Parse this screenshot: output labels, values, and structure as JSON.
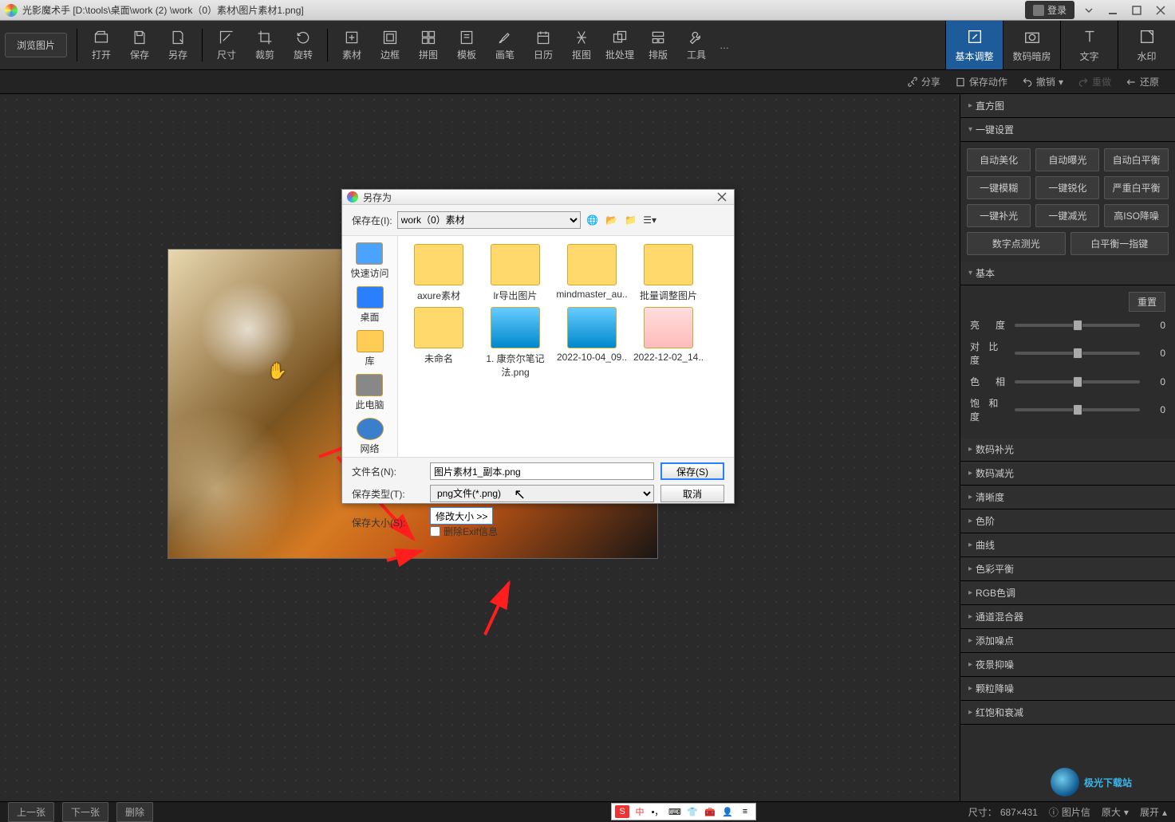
{
  "title": "光影魔术手  [D:\\tools\\桌面\\work (2) \\work（0）素材\\图片素材1.png]",
  "login_label": "登录",
  "toolbar": {
    "browse": "浏览图片",
    "items": [
      {
        "key": "open",
        "label": "打开"
      },
      {
        "key": "save",
        "label": "保存"
      },
      {
        "key": "saveas",
        "label": "另存"
      },
      {
        "key": "size",
        "label": "尺寸"
      },
      {
        "key": "crop",
        "label": "裁剪"
      },
      {
        "key": "rotate",
        "label": "旋转"
      },
      {
        "key": "material",
        "label": "素材"
      },
      {
        "key": "border",
        "label": "边框"
      },
      {
        "key": "collage",
        "label": "拼图"
      },
      {
        "key": "template",
        "label": "模板"
      },
      {
        "key": "brush",
        "label": "画笔"
      },
      {
        "key": "calendar",
        "label": "日历"
      },
      {
        "key": "cutout",
        "label": "抠图"
      },
      {
        "key": "batch",
        "label": "批处理"
      },
      {
        "key": "layout",
        "label": "排版"
      },
      {
        "key": "tools",
        "label": "工具"
      }
    ],
    "more": "…",
    "right_tabs": [
      {
        "key": "basic",
        "label": "基本调整",
        "active": true
      },
      {
        "key": "darkroom",
        "label": "数码暗房",
        "active": false
      },
      {
        "key": "text",
        "label": "文字",
        "active": false
      },
      {
        "key": "watermark",
        "label": "水印",
        "active": false
      }
    ]
  },
  "actions": {
    "share": "分享",
    "save_action": "保存动作",
    "undo": "撤销",
    "redo": "重做",
    "restore": "还原"
  },
  "panel": {
    "histogram": "直方图",
    "onekey_title": "一键设置",
    "onekey": [
      "自动美化",
      "自动曝光",
      "自动白平衡",
      "一键模糊",
      "一键锐化",
      "严重白平衡",
      "一键补光",
      "一键减光",
      "高ISO降噪",
      "数字点测光",
      "白平衡一指键"
    ],
    "basic_title": "基本",
    "reset": "重置",
    "sliders": [
      {
        "label": "亮　度",
        "value": "0"
      },
      {
        "label": "对 比 度",
        "value": "0"
      },
      {
        "label": "色　相",
        "value": "0"
      },
      {
        "label": "饱 和 度",
        "value": "0"
      }
    ],
    "sections": [
      "数码补光",
      "数码减光",
      "清晰度",
      "色阶",
      "曲线",
      "色彩平衡",
      "RGB色调",
      "通道混合器",
      "添加噪点",
      "夜景抑噪",
      "颗粒降噪",
      "红饱和衰减"
    ]
  },
  "saveDialog": {
    "title": "另存为",
    "save_in_label": "保存在(I):",
    "save_in_value": "work（0）素材",
    "places": [
      {
        "key": "quick",
        "label": "快速访问"
      },
      {
        "key": "desktop",
        "label": "桌面"
      },
      {
        "key": "libs",
        "label": "库"
      },
      {
        "key": "pc",
        "label": "此电脑"
      },
      {
        "key": "net",
        "label": "网络"
      }
    ],
    "files": [
      {
        "name": "axure素材",
        "type": "folder"
      },
      {
        "name": "lr导出图片",
        "type": "folder"
      },
      {
        "name": "mindmaster_au..",
        "type": "folder"
      },
      {
        "name": "批量调整图片",
        "type": "folder"
      },
      {
        "name": "未命名",
        "type": "folder"
      },
      {
        "name": "1. 康奈尔笔记法.png",
        "type": "img"
      },
      {
        "name": "2022-10-04_09..",
        "type": "img"
      },
      {
        "name": "2022-12-02_14..",
        "type": "photo"
      }
    ],
    "filename_label": "文件名(N):",
    "filename_value": "图片素材1_副本.png",
    "filetype_label": "保存类型(T):",
    "filetype_value": "png文件(*.png)",
    "filesize_label": "保存大小(S):",
    "filesize_btn": "修改大小 >>",
    "exif_label": "删除Exif信息",
    "save_btn": "保存(S)",
    "cancel_btn": "取消"
  },
  "status": {
    "prev": "上一张",
    "next": "下一张",
    "delete": "删除",
    "dim_label": "尺寸：",
    "dim_value": "687×431",
    "info": "图片信",
    "osize": "原大",
    "expand": "展开"
  },
  "watermark_text": "极光下载站"
}
